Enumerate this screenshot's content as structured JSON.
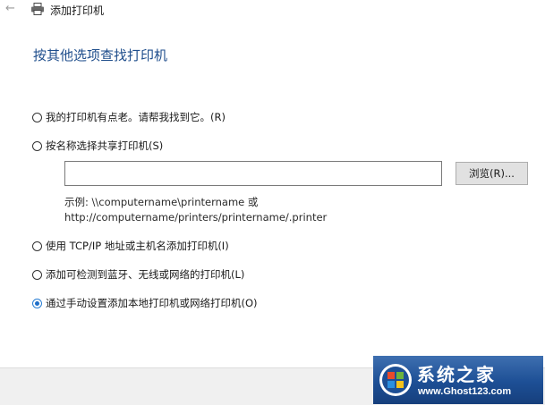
{
  "window": {
    "title": "添加打印机"
  },
  "main": {
    "heading": "按其他选项查找打印机",
    "options": [
      {
        "label": "我的打印机有点老。请帮我找到它。(R)",
        "checked": false
      },
      {
        "label": "按名称选择共享打印机(S)",
        "checked": false
      },
      {
        "label": "使用 TCP/IP 地址或主机名添加打印机(I)",
        "checked": false
      },
      {
        "label": "添加可检测到蓝牙、无线或网络的打印机(L)",
        "checked": false
      },
      {
        "label": "通过手动设置添加本地打印机或网络打印机(O)",
        "checked": true
      }
    ],
    "share_input": {
      "value": "",
      "placeholder": ""
    },
    "browse_button": "浏览(R)...",
    "example_line1": "示例: \\\\computername\\printername 或",
    "example_line2": "http://computername/printers/printername/.printer"
  },
  "watermark": {
    "title": "系统之家",
    "url": "www.Ghost123.com"
  },
  "icons": {
    "back": "back-arrow-icon",
    "printer": "printer-icon",
    "watermark_logo": "windows-logo-icon"
  },
  "colors": {
    "heading": "#1f4e8c",
    "radio_selected": "#1f6fc8",
    "footer_bg": "#f0f0f0",
    "watermark_bg": "#1d4f95"
  }
}
